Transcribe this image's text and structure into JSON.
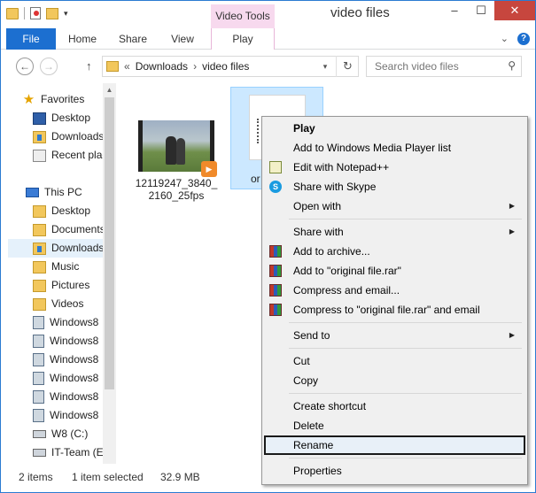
{
  "window": {
    "title": "video files",
    "contextual_tab_group": "Video Tools",
    "controls": {
      "minimize": "–",
      "maximize": "☐",
      "close": "✕"
    }
  },
  "ribbon": {
    "tabs": [
      "File",
      "Home",
      "Share",
      "View",
      "Play"
    ],
    "expand_glyph": "⌄",
    "help_glyph": "?"
  },
  "address_bar": {
    "back_glyph": "←",
    "forward_glyph": "→",
    "up_glyph": "↑",
    "overflow_glyph": "«",
    "crumbs": [
      "Downloads",
      "video files"
    ],
    "separator": "›",
    "dropdown_glyph": "▾",
    "refresh_glyph": "↻",
    "search_placeholder": "Search video files",
    "search_glyph": "⚲"
  },
  "nav_pane": {
    "favorites_label": "Favorites",
    "favorites": [
      "Desktop",
      "Downloads",
      "Recent places"
    ],
    "this_pc_label": "This PC",
    "this_pc": [
      "Desktop",
      "Documents",
      "Downloads",
      "Music",
      "Pictures",
      "Videos",
      "Windows8",
      "Windows8",
      "Windows8",
      "Windows8",
      "Windows8",
      "Windows8",
      "W8 (C:)",
      "IT-Team (E:)"
    ],
    "scroll_up_glyph": "▲"
  },
  "files": [
    {
      "name": "12119247_3840_2160_25fps",
      "selected": false
    },
    {
      "name": "original file",
      "name_visible": "or",
      "selected": true
    }
  ],
  "status_bar": {
    "item_count": "2 items",
    "selection": "1 item selected",
    "size": "32.9 MB"
  },
  "context_menu": {
    "items": [
      {
        "label": "Play",
        "bold": true
      },
      {
        "label": "Add to Windows Media Player list"
      },
      {
        "label": "Edit with Notepad++",
        "icon": "notepadpp-icon"
      },
      {
        "label": "Share with Skype",
        "icon": "skype-icon"
      },
      {
        "label": "Open with",
        "submenu": true
      },
      {
        "label": "Share with",
        "submenu": true
      },
      {
        "label": "Add to archive...",
        "icon": "winrar-icon"
      },
      {
        "label": "Add to \"original file.rar\"",
        "icon": "winrar-icon"
      },
      {
        "label": "Compress and email...",
        "icon": "winrar-icon"
      },
      {
        "label": "Compress to \"original file.rar\" and email",
        "icon": "winrar-icon"
      },
      {
        "label": "Send to",
        "submenu": true
      },
      {
        "label": "Cut"
      },
      {
        "label": "Copy"
      },
      {
        "label": "Create shortcut"
      },
      {
        "label": "Delete"
      },
      {
        "label": "Rename",
        "highlighted": true
      },
      {
        "label": "Properties"
      }
    ],
    "submenu_glyph": "▶"
  },
  "colors": {
    "accent": "#1c6fd0",
    "contextual_tab": "#f7d9ee",
    "close_button": "#c7463e",
    "selection": "#cce8ff"
  }
}
